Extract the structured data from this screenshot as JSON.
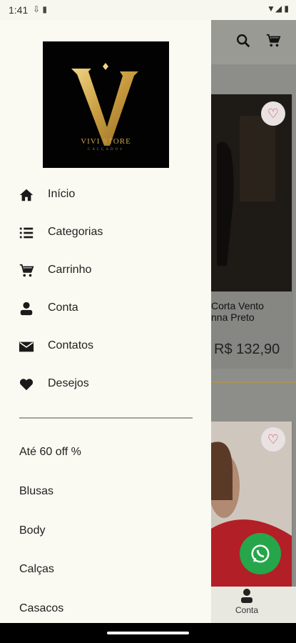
{
  "status_bar": {
    "time": "1:41",
    "left_icons": "⇩ ▮",
    "right_icons": "▼◢ ▮"
  },
  "drawer": {
    "logo": {
      "brand_text": "VIVI STORE",
      "sub_text": "CALÇADOS"
    },
    "menu": [
      {
        "label": "Início",
        "icon": "home-icon"
      },
      {
        "label": "Categorias",
        "icon": "list-icon"
      },
      {
        "label": "Carrinho",
        "icon": "cart-icon"
      },
      {
        "label": "Conta",
        "icon": "person-icon"
      },
      {
        "label": "Contatos",
        "icon": "mail-icon"
      },
      {
        "label": "Desejos",
        "icon": "heart-icon"
      }
    ],
    "categories": [
      "Até 60 off %",
      "Blusas",
      "Body",
      "Calças",
      "Casacos"
    ]
  },
  "background": {
    "product_1": {
      "title_line1": "Corta Vento",
      "title_line2": "nna Preto",
      "price": "R$  132,90"
    },
    "bottom_nav": {
      "label": "Conta"
    }
  },
  "colors": {
    "accent_gold": "#c9a24a",
    "favorite_red": "#d23d55",
    "whatsapp_green": "#26a64a",
    "drawer_bg": "#fafaf2"
  }
}
